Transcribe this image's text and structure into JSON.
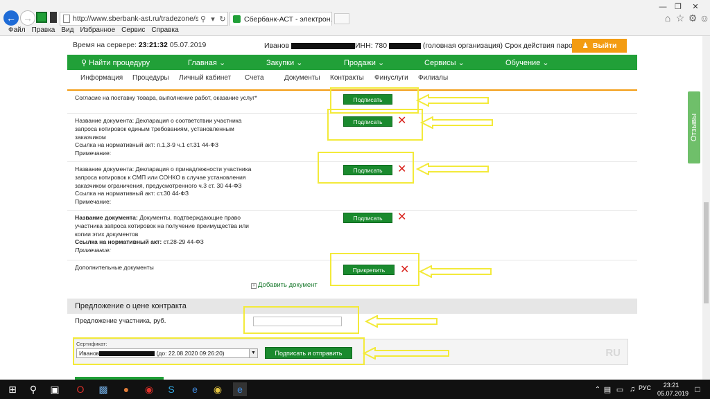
{
  "browser": {
    "address": "http://www.sberbank-ast.ru/tradezone/supplier/ZK/Purc",
    "tab_title": "Сбербанк-АСТ - электрон...",
    "menu": [
      "Файл",
      "Правка",
      "Вид",
      "Избранное",
      "Сервис",
      "Справка"
    ]
  },
  "header": {
    "server_label": "Время на сервере:",
    "server_time": "23:21:32",
    "server_date": "05.07.2019",
    "user_name": "Иванов",
    "inn_label": "ИНН: 780",
    "org_text": "(головная организация) Срок действия пароля истек",
    "logout_label": "Выйти"
  },
  "main_nav": {
    "search": "Найти процедуру",
    "main": "Главная",
    "purchases": "Закупки",
    "sales": "Продажи",
    "services": "Сервисы",
    "training": "Обучение"
  },
  "sub_nav": [
    "Информация",
    "Процедуры",
    "Личный кабинет",
    "Счета",
    "Документы",
    "Контракты",
    "Финуслуги",
    "Филиалы"
  ],
  "rows": {
    "r1": {
      "text": "Согласие на поставку товара, выполнение работ, оказание услуг*"
    },
    "r2": {
      "name_label": "Название документа:",
      "name": "Декларация о соответствии участника запроса котировок единым требованиям, установленным заказчиком",
      "act_label": "Ссылка на нормативный акт:",
      "act": "п.1,3-9 ч.1 ст.31 44-ФЗ",
      "note_label": "Примечание:"
    },
    "r3": {
      "name_label": "Название документа:",
      "name": "Декларация о принадлежности участника запроса котировок к СМП или СОНКО в случае установления заказчиком ограничения, предусмотренного ч.3 ст. 30 44-ФЗ",
      "act_label": "Ссылка на нормативный акт:",
      "act": "ст.30 44-ФЗ",
      "note_label": "Примечание:"
    },
    "r4": {
      "name_label": "Название документа:",
      "name": "Документы, подтверждающие право участника запроса котировок на получение преимущества или копии этих документов",
      "act_label": "Ссылка на нормативный акт:",
      "act": "ст.28-29 44-ФЗ",
      "note_label": "Примечание:"
    },
    "r5": {
      "text": "Дополнительные документы"
    }
  },
  "buttons": {
    "sign": "Подписать",
    "attach": "Прикрепить",
    "add_doc": "Добавить документ",
    "sign_send": "Подписать и отправить"
  },
  "price": {
    "section_title": "Предложение о цене контракта",
    "label": "Предложение участника, руб.",
    "value": ""
  },
  "certificate": {
    "label": "Сертификат:",
    "prefix": "Иванов",
    "validity": "(до: 22.08.2020 09:26:20)"
  },
  "watermark": "RU",
  "feedback_label": "Отзывы",
  "taskbar": {
    "lang": "РУС",
    "time": "23:21",
    "date": "05.07.2019"
  },
  "colors": {
    "brand_green": "#21a038",
    "button_green": "#1a8a2e",
    "accent_orange": "#f39c12",
    "annotation_yellow": "#f3ea3a",
    "delete_red": "#d9231d"
  }
}
